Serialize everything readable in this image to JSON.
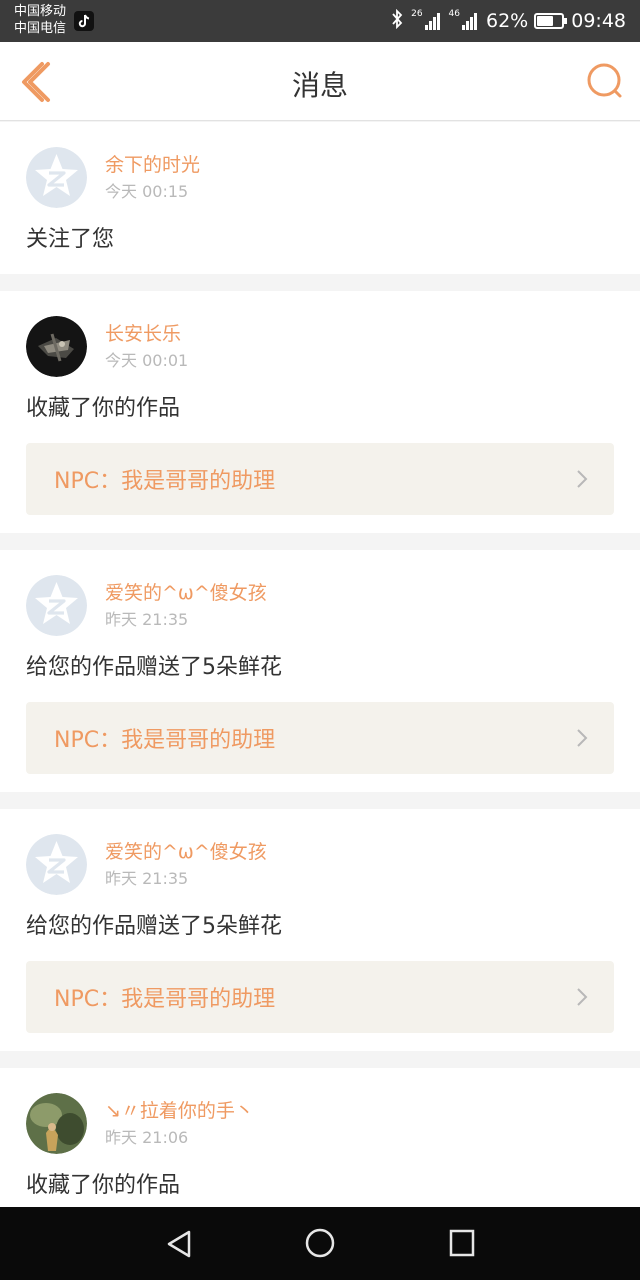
{
  "status_bar": {
    "carrier_1": "中国移动",
    "carrier_2": "中国电信",
    "network_1": "26",
    "network_2": "46",
    "battery": "62%",
    "battery_level": 0.62,
    "time": "09:48"
  },
  "header": {
    "title": "消息",
    "back_icon": "chevron-left-icon",
    "search_icon": "search-icon"
  },
  "messages": [
    {
      "username": "余下的时光",
      "time": "今天 00:15",
      "action": "关注了您",
      "avatar": "default-avatar"
    },
    {
      "username": "长安长乐",
      "time": "今天 00:01",
      "action": "收藏了你的作品",
      "avatar": "photo-avatar-dark",
      "attachment": "NPC：我是哥哥的助理"
    },
    {
      "username": "爱笑的^ω^傻女孩",
      "time": "昨天 21:35",
      "action": "给您的作品赠送了5朵鲜花",
      "avatar": "default-avatar",
      "attachment": "NPC：我是哥哥的助理"
    },
    {
      "username": "爱笑的^ω^傻女孩",
      "time": "昨天 21:35",
      "action": "给您的作品赠送了5朵鲜花",
      "avatar": "default-avatar",
      "attachment": "NPC：我是哥哥的助理"
    },
    {
      "username": "↘〃拉着你的手丶",
      "time": "昨天 21:06",
      "action": "收藏了你的作品",
      "avatar": "photo-avatar-nature"
    }
  ],
  "colors": {
    "accent": "#ef9a62",
    "attachment_bg": "#f4f2ec",
    "status_bar_bg": "#3b3b3b",
    "nav_bar_bg": "#0a0a0a"
  }
}
